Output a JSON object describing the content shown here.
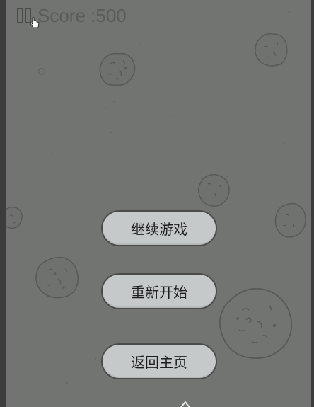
{
  "hud": {
    "score_text": "Score :500",
    "pause_icon": "pause-icon",
    "cursor_icon": "hand-pointer-icon"
  },
  "pause_menu": {
    "continue_label": "继续游戏",
    "restart_label": "重新开始",
    "home_label": "返回主页"
  },
  "colors": {
    "background": "#7e807e",
    "frame": "#3c3c3c",
    "button_fill": "#c5c9c9",
    "button_border": "#4a4c4a",
    "score_text": "#5a5c5a"
  }
}
